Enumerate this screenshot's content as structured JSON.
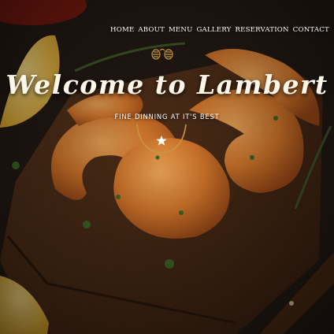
{
  "nav": {
    "items": [
      "HOME",
      "ABOUT",
      "MENU",
      "GALLERY",
      "RESERVATION",
      "CONTACT"
    ]
  },
  "hero": {
    "title": "Welcome to Lambert",
    "subtitle": "FINE DINNING AT IT'S BEST"
  },
  "icons": {
    "crest": "hop-cones-crest-icon",
    "star": "star-icon"
  },
  "colors": {
    "accent": "#c8963e",
    "text": "#ffffff"
  }
}
